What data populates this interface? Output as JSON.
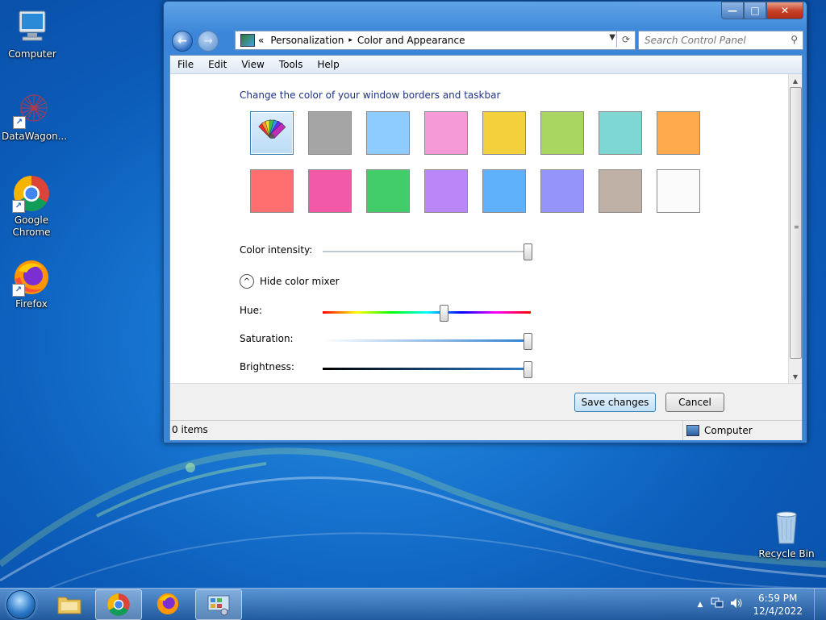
{
  "desktop": {
    "icons": [
      {
        "label": "Computer"
      },
      {
        "label": "DataWagon..."
      },
      {
        "label": "Google Chrome"
      },
      {
        "label": "Firefox"
      },
      {
        "label": "Recycle Bin"
      }
    ]
  },
  "window": {
    "controls": {
      "minimize": "—",
      "maximize": "□",
      "close": "✕"
    },
    "nav": {
      "back": "←",
      "forward": "→"
    },
    "breadcrumb": {
      "prefix": "«",
      "items": [
        "Personalization",
        "Color and Appearance"
      ],
      "separator": "▸"
    },
    "search": {
      "placeholder": "Search Control Panel"
    },
    "menu": [
      "File",
      "Edit",
      "View",
      "Tools",
      "Help"
    ],
    "heading": "Change the color of your window borders and taskbar",
    "swatches": {
      "row1": [
        "custom",
        "#a5a5a5",
        "#8ecbff",
        "#f49ad6",
        "#f3d03c",
        "#a9d660",
        "#7fd7d4",
        "#ffaa4c"
      ],
      "row2": [
        "#ff6f6f",
        "#f25aa8",
        "#42cc6a",
        "#bb86f7",
        "#5fb1fb",
        "#9594fb",
        "#bfb1a6",
        "#fbfbfb"
      ],
      "selected_index": 0
    },
    "color_intensity": {
      "label": "Color intensity:",
      "value": 1.0
    },
    "mixer": {
      "toggle_label": "Hide color mixer",
      "hue": {
        "label": "Hue:",
        "value": 0.58
      },
      "saturation": {
        "label": "Saturation:",
        "value": 1.0
      },
      "brightness": {
        "label": "Brightness:",
        "value": 1.0
      }
    },
    "buttons": {
      "save": "Save changes",
      "cancel": "Cancel"
    },
    "status": {
      "items": "0 items",
      "location": "Computer"
    }
  },
  "taskbar": {
    "clock": {
      "time": "6:59 PM",
      "date": "12/4/2022"
    },
    "tray_arrow": "▲"
  },
  "colors": {
    "accent": "#1e3287",
    "desktop": "#1673cf"
  }
}
